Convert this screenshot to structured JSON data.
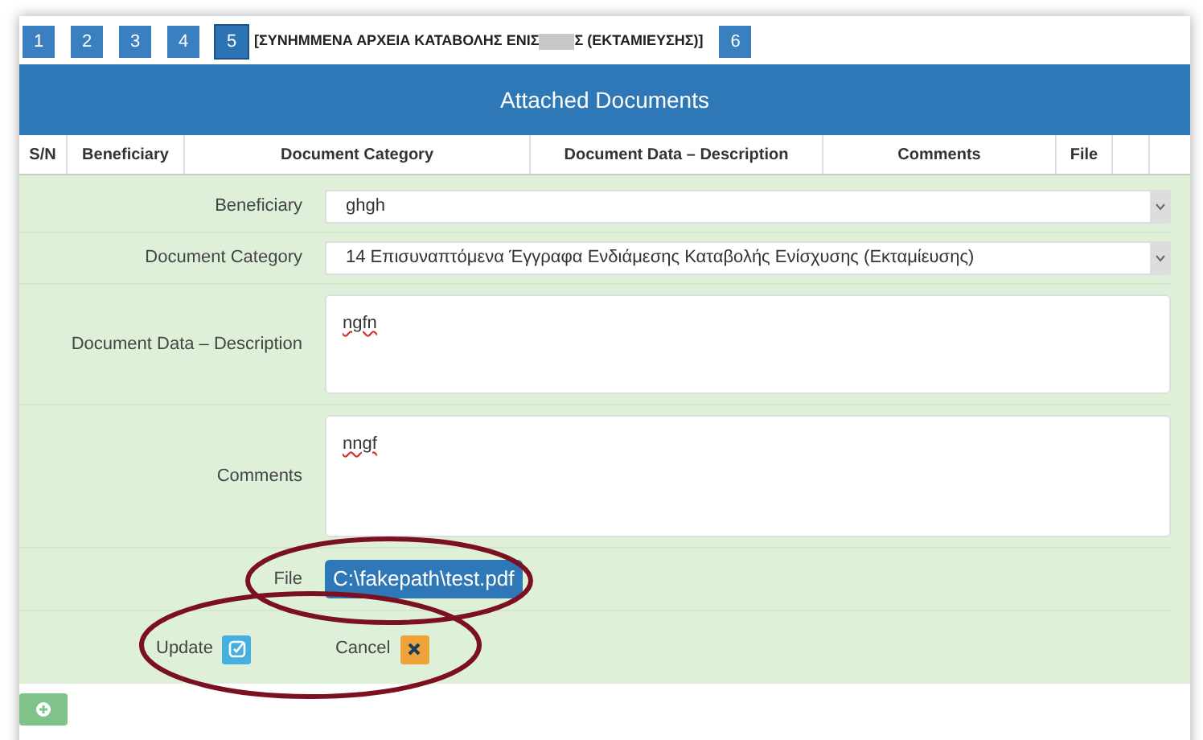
{
  "steps": [
    {
      "label": "1",
      "selected": false
    },
    {
      "label": "2",
      "selected": false
    },
    {
      "label": "3",
      "selected": false
    },
    {
      "label": "4",
      "selected": false
    },
    {
      "label": "5",
      "selected": true
    },
    {
      "label": "6",
      "selected": false
    }
  ],
  "current_step_title": {
    "start": "[ΣΥΝΗΜΜΕΝΑ ΑΡΧΕΙΑ ΚΑΤΑΒΟΛΗΣ ΕΝΙΣ",
    "end": "Σ (ΕΚΤΑΜΙΕΥΣΗΣ)]"
  },
  "panel_title": "Attached Documents",
  "table": {
    "columns": [
      "S/N",
      "Beneficiary",
      "Document Category",
      "Document Data – Description",
      "Comments",
      "File"
    ]
  },
  "form": {
    "fields": [
      {
        "kind": "select",
        "label": "Beneficiary",
        "value": "ghgh"
      },
      {
        "kind": "select",
        "label": "Document Category",
        "value": "14 Επισυναπτόμενα Έγγραφα Ενδιάμεσης Καταβολής Ενίσχυσης (Εκταμίευσης)"
      },
      {
        "kind": "textarea",
        "label": "Document Data – Description",
        "value": "ngfn"
      },
      {
        "kind": "textarea",
        "label": "Comments",
        "value": "nngf"
      },
      {
        "kind": "file",
        "label": "File",
        "value": "C:\\fakepath\\test.pdf"
      }
    ],
    "actions": [
      {
        "kind": "update",
        "label": "Update"
      },
      {
        "kind": "cancel",
        "label": "Cancel"
      }
    ]
  }
}
